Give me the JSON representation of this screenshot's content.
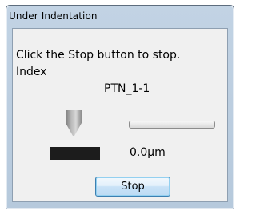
{
  "window": {
    "title": "Under Indentation"
  },
  "dialog": {
    "message": "Click the Stop button to stop.",
    "index_label": "Index",
    "index_value": "PTN_1-1",
    "indenter_icon": "indenter-tip-icon",
    "progress_fraction": 0.0,
    "depth_value": "0.0μm",
    "stop_label": "Stop"
  },
  "colors": {
    "title_bar": "#b9cde0",
    "client_bg": "#f0f0f0",
    "button_border": "#3c7fb1"
  }
}
